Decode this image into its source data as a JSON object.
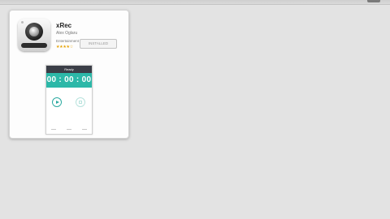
{
  "app": {
    "title": "xRec",
    "developer": "Alex Oglaru",
    "category": "Entertainment",
    "rating": "★★★★☆",
    "install_label": "INSTALLED"
  },
  "preview": {
    "header": "Ready",
    "timer": "00 : 00 : 00"
  },
  "icons": {
    "app": "camera-lens-icon",
    "play": "play-icon",
    "stop": "stop-icon"
  },
  "colors": {
    "accent": "#2cb8a8",
    "preview_header": "#3b3e47",
    "rating": "#e5a100",
    "background": "#e3e3e3"
  }
}
